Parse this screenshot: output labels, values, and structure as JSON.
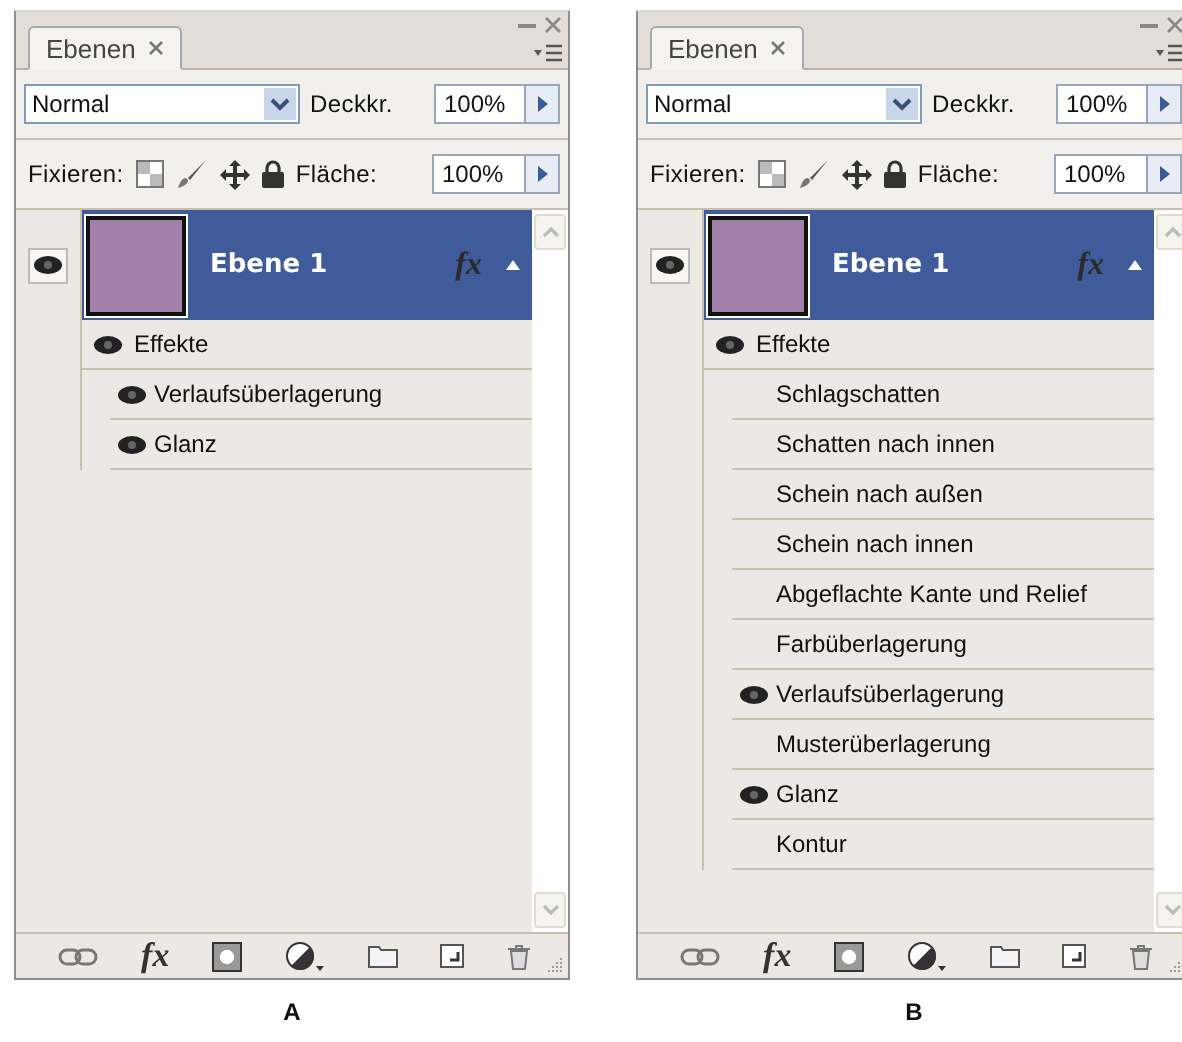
{
  "panels": [
    {
      "caption": "A",
      "tab": {
        "label": "Ebenen",
        "selected": true
      },
      "blend_mode": "Normal",
      "opacity": {
        "label": "Deckkr.",
        "value": "100%"
      },
      "lock_label": "Fixieren:",
      "fill": {
        "label": "Fläche:",
        "value": "100%"
      },
      "layers": [
        {
          "name": "Ebene 1",
          "visible": true,
          "selected": true,
          "fx": "fx",
          "expanded": true,
          "effects": {
            "label": "Effekte",
            "visible": true,
            "children": [
              {
                "name": "Verlaufsüberlagerung",
                "visible": true
              },
              {
                "name": "Glanz",
                "visible": true
              }
            ]
          }
        }
      ],
      "toolbar": [
        {
          "kind": "link"
        },
        {
          "kind": "fx",
          "label": "fx"
        },
        {
          "kind": "mask"
        },
        {
          "kind": "adjust"
        },
        {
          "kind": "folder"
        },
        {
          "kind": "new"
        },
        {
          "kind": "trash"
        }
      ]
    },
    {
      "caption": "B",
      "tab": {
        "label": "Ebenen",
        "selected": true
      },
      "blend_mode": "Normal",
      "opacity": {
        "label": "Deckkr.",
        "value": "100%"
      },
      "lock_label": "Fixieren:",
      "fill": {
        "label": "Fläche:",
        "value": "100%"
      },
      "layers": [
        {
          "name": "Ebene 1",
          "visible": true,
          "selected": true,
          "fx": "fx",
          "expanded": true,
          "effects": {
            "label": "Effekte",
            "visible": true,
            "children": [
              {
                "name": "Schlagschatten",
                "visible": false
              },
              {
                "name": "Schatten nach innen",
                "visible": false
              },
              {
                "name": "Schein nach außen",
                "visible": false
              },
              {
                "name": "Schein nach innen",
                "visible": false
              },
              {
                "name": "Abgeflachte Kante und Relief",
                "visible": false
              },
              {
                "name": "Farbüberlagerung",
                "visible": false
              },
              {
                "name": "Verlaufsüberlagerung",
                "visible": true
              },
              {
                "name": "Musterüberlagerung",
                "visible": false
              },
              {
                "name": "Glanz",
                "visible": true
              },
              {
                "name": "Kontur",
                "visible": false
              }
            ]
          }
        }
      ],
      "toolbar": [
        {
          "kind": "link"
        },
        {
          "kind": "fx",
          "label": "fx"
        },
        {
          "kind": "mask"
        },
        {
          "kind": "adjust"
        },
        {
          "kind": "folder"
        },
        {
          "kind": "new"
        },
        {
          "kind": "trash"
        }
      ]
    }
  ]
}
